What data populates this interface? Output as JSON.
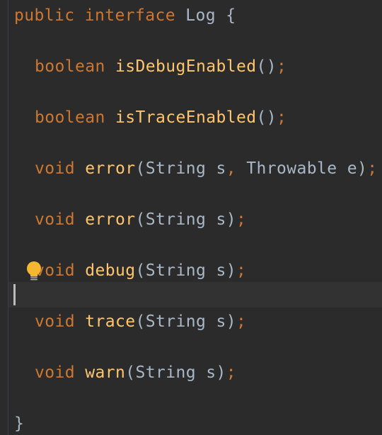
{
  "code": {
    "line1": {
      "kw1": "public",
      "kw2": "interface",
      "name": "Log",
      "brace": "{"
    },
    "line2": {
      "type": "boolean",
      "method": "isDebugEnabled",
      "params": "()",
      "semi": ";"
    },
    "line3": {
      "type": "boolean",
      "method": "isTraceEnabled",
      "params": "()",
      "semi": ";"
    },
    "line4": {
      "type": "void",
      "method": "error",
      "open": "(",
      "p1": "String s",
      "comma": ",",
      "p2": " Throwable e",
      "close": ")",
      "semi": ";"
    },
    "line5": {
      "type": "void",
      "method": "error",
      "params": "(String s)",
      "semi": ";"
    },
    "line6": {
      "type": "void",
      "method": "debug",
      "params": "(String s)",
      "semi": ";"
    },
    "line7": {
      "type": "void",
      "method": "trace",
      "params": "(String s)",
      "semi": ";"
    },
    "line8": {
      "type": "void",
      "method": "warn",
      "params": "(String s)",
      "semi": ";"
    },
    "line9": {
      "brace": "}"
    }
  },
  "icons": {
    "intention": "lightbulb-icon"
  },
  "colors": {
    "background": "#2b2b2b",
    "keyword": "#cc7832",
    "method": "#ffc66d",
    "text": "#a9b7c6",
    "current_line": "#323232",
    "bulb": "#f5b731"
  }
}
